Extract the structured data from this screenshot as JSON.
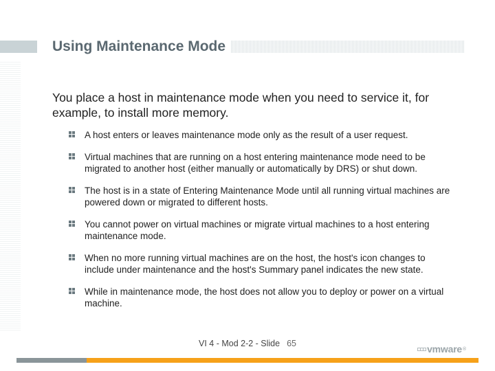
{
  "title": "Using Maintenance Mode",
  "intro": "You place a host in maintenance mode when you need to service it, for example, to install more memory.",
  "bullets": [
    "A host enters or leaves maintenance mode only as the result of a user request.",
    "Virtual machines that are running on a host entering maintenance mode need to be migrated to another host (either manually or automatically by DRS) or shut down.",
    "The host is in a state of Entering Maintenance Mode until all running virtual machines are powered down or migrated to different hosts.",
    "You cannot power on virtual machines or migrate virtual machines to a host entering maintenance mode.",
    "When no more running virtual machines are on the host, the host's icon changes to include under maintenance and the host's Summary panel indicates the new state.",
    "While in maintenance mode, the host does not allow you to deploy or power on a virtual machine."
  ],
  "footer": {
    "label": "VI 4 - Mod 2-2 - Slide",
    "page": "65"
  },
  "logo": "vmware"
}
